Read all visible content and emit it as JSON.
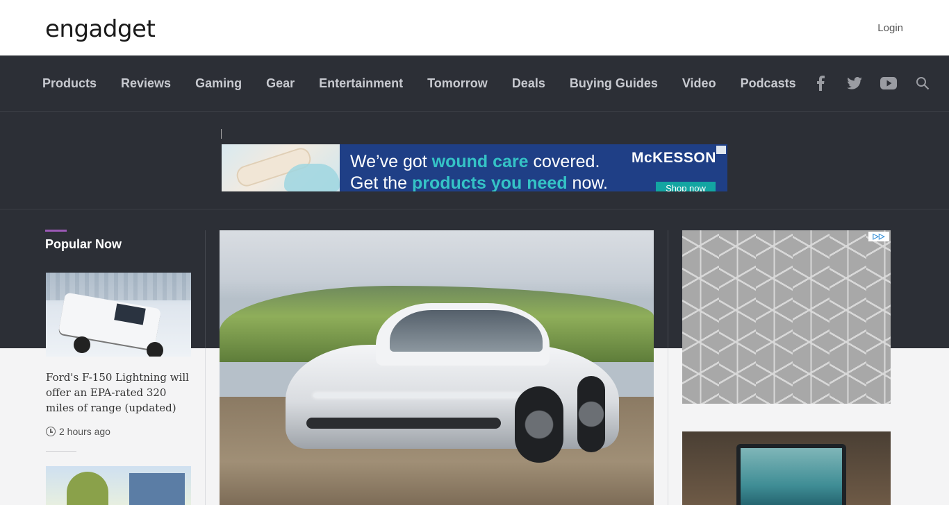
{
  "header": {
    "logo_text": "engadget",
    "login_label": "Login"
  },
  "nav": {
    "items": [
      "Products",
      "Reviews",
      "Gaming",
      "Gear",
      "Entertainment",
      "Tomorrow",
      "Deals",
      "Buying Guides",
      "Video",
      "Podcasts"
    ],
    "icons": [
      "facebook-icon",
      "twitter-icon",
      "youtube-icon",
      "search-icon"
    ]
  },
  "ad_banner": {
    "line1_pre": "We’ve got ",
    "line1_highlight": "wound care",
    "line1_post": " covered.",
    "line2_pre": "Get the ",
    "line2_highlight": "products you need",
    "line2_post": " now.",
    "brand": "McKESSON",
    "cta": "Shop now"
  },
  "popular": {
    "title": "Popular Now",
    "story1": {
      "headline": "Ford's F-150 Lightning will offer an EPA-rated 320 miles of range (updated)",
      "time": "2 hours ago"
    }
  },
  "colors": {
    "accent": "#9b59b6",
    "nav_bg": "#2c2f36",
    "ad_highlight": "#35c3c6"
  }
}
